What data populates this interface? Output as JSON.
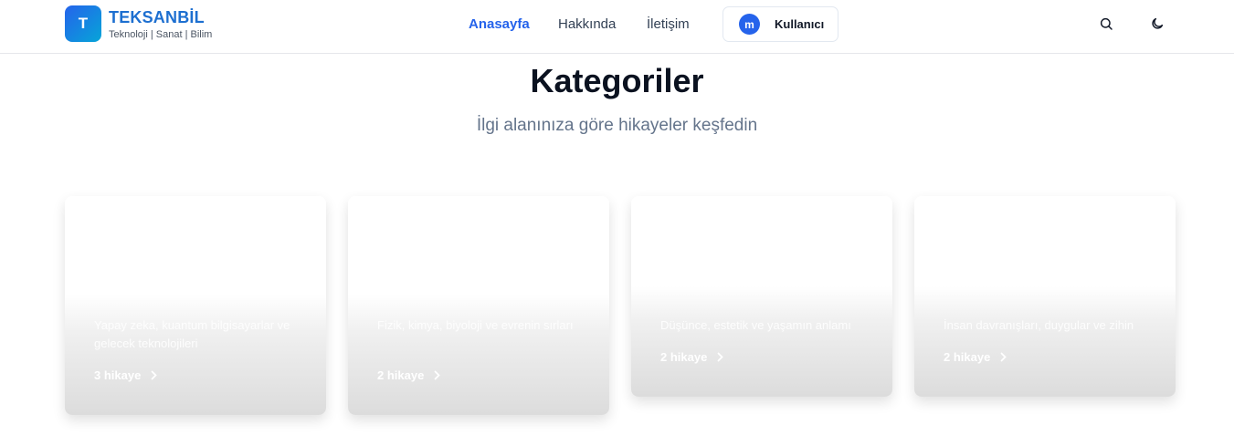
{
  "brand": {
    "logo_letter": "T",
    "name": "TEKSANBİL",
    "tagline": "Teknoloji | Sanat | Bilim"
  },
  "nav": {
    "home": "Anasayfa",
    "about": "Hakkında",
    "contact": "İletişim"
  },
  "user": {
    "initial": "m",
    "name": "Kullanıcı"
  },
  "icons": {
    "search": "search-icon",
    "theme": "moon-icon"
  },
  "hero": {
    "title": "Kategoriler",
    "subtitle": "İlgi alanınıza göre hikayeler keşfedin"
  },
  "categories": [
    {
      "title": "",
      "description": "Yapay zeka, kuantum bilgisayarlar ve gelecek teknolojileri",
      "count": "3 hikaye"
    },
    {
      "title": "",
      "description": "Fizik, kimya, biyoloji ve evrenin sırları",
      "count": "2 hikaye"
    },
    {
      "title": "",
      "description": "Düşünce, estetik ve yaşamın anlamı",
      "count": "2 hikaye"
    },
    {
      "title": "",
      "description": "İnsan davranışları, duygular ve zihin",
      "count": "2 hikaye"
    }
  ],
  "colors": {
    "accent": "#2563eb",
    "brand_text": "#1d6fd0",
    "muted": "#64748b"
  }
}
